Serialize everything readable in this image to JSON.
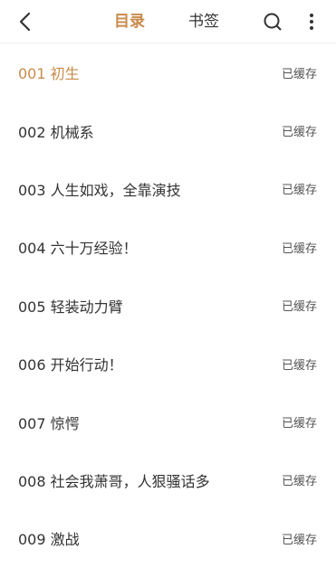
{
  "header": {
    "tabs": [
      {
        "label": "目录",
        "active": true
      },
      {
        "label": "书签",
        "active": false
      }
    ],
    "icons": {
      "back": "chevron-left-icon",
      "search": "search-icon",
      "more": "more-vertical-icon"
    }
  },
  "colors": {
    "accent": "#c98a4b",
    "text": "#333333",
    "muted": "#555555"
  },
  "chapters": [
    {
      "title": "001 初生",
      "status": "已缓存",
      "current": true
    },
    {
      "title": "002 机械系",
      "status": "已缓存",
      "current": false
    },
    {
      "title": "003 人生如戏，全靠演技",
      "status": "已缓存",
      "current": false
    },
    {
      "title": "004 六十万经验！",
      "status": "已缓存",
      "current": false
    },
    {
      "title": "005 轻装动力臂",
      "status": "已缓存",
      "current": false
    },
    {
      "title": "006 开始行动！",
      "status": "已缓存",
      "current": false
    },
    {
      "title": "007 惊愕",
      "status": "已缓存",
      "current": false
    },
    {
      "title": "008 社会我萧哥，人狠骚话多",
      "status": "已缓存",
      "current": false
    },
    {
      "title": "009 激战",
      "status": "已缓存",
      "current": false
    }
  ]
}
